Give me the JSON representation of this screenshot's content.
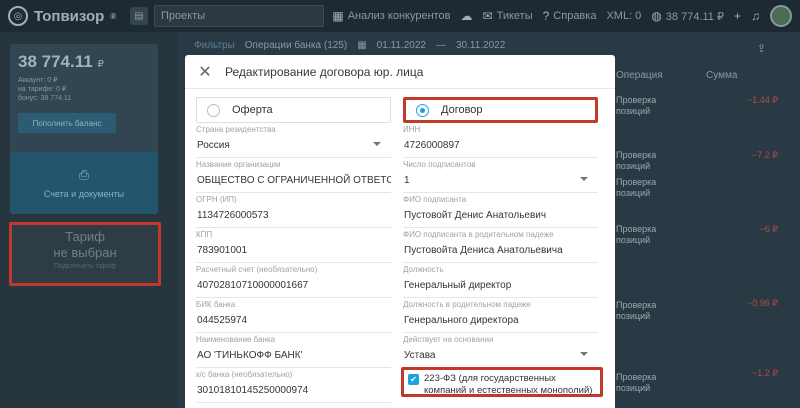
{
  "topbar": {
    "logo_text": "Топвизор",
    "logo_reg": "®",
    "projects_label": "Проекты",
    "competitors_label": "Анализ конкурентов",
    "tickets_label": "Тикеты",
    "help_label": "Справка",
    "xml_label": "XML: 0",
    "balance_label": "38 774.11 ₽",
    "plus_icon": "+"
  },
  "sidebar": {
    "balance_amount": "38 774.11",
    "balance_currency": "₽",
    "balance_line_1": "Аккаунт:   0 ₽",
    "balance_line_2": "на тарифе:   0 ₽",
    "balance_line_3": "бонус: 38 774.11",
    "topup_label": "Пополнить баланс",
    "docs_label": "Счета и документы",
    "tariff_title_1": "Тариф",
    "tariff_title_2": "не выбран",
    "tariff_sub": "Подключить тариф"
  },
  "content": {
    "filters_label": "Фильтры",
    "operations_label": "Операции банка",
    "operations_count": "(125)",
    "date_from": "01.11.2022",
    "date_to": "30.11.2022",
    "col_operation": "Операция",
    "col_sum": "Сумма",
    "rows": [
      {
        "op_1": "Проверка",
        "op_2": "позиций",
        "sum": "−1.44 ₽"
      },
      {
        "op_1": "Проверка",
        "op_2": "позиций",
        "sum": "−7.2 ₽"
      },
      {
        "op_1": "Проверка",
        "op_2": "позиций",
        "sum": ""
      },
      {
        "op_1": "Проверка",
        "op_2": "позиций",
        "sum": "−6 ₽"
      },
      {
        "op_1": "Проверка",
        "op_2": "позиций",
        "sum": ""
      },
      {
        "op_1": "Проверка",
        "op_2": "позиций",
        "sum": "−0.96 ₽"
      },
      {
        "op_1": "Проверка",
        "op_2": "позиций",
        "sum": "−1.2 ₽"
      }
    ]
  },
  "modal": {
    "title": "Редактирование договора юр. лица",
    "radio_offer": "Оферта",
    "radio_contract": "Договор",
    "left_fields": [
      {
        "label": "Страна резидентства",
        "value": "Россия",
        "select": true
      },
      {
        "label": "Название организации",
        "value": "ОБЩЕСТВО С ОГРАНИЧЕННОЙ ОТВЕТСТВЕННОСТЬЮ",
        "select": false
      },
      {
        "label": "ОГРН (ИП)",
        "value": "1134726000573",
        "select": false
      },
      {
        "label": "КПП",
        "value": "783901001",
        "select": false
      },
      {
        "label": "Расчетный счет (необязательно)",
        "value": "40702810710000001667",
        "select": false
      },
      {
        "label": "БИК банка",
        "value": "044525974",
        "select": false
      },
      {
        "label": "Наименование банка",
        "value": "АО 'ТИНЬКОФФ БАНК'",
        "select": false
      },
      {
        "label": "к/с банка (необязательно)",
        "value": "30101810145250000974",
        "select": false
      }
    ],
    "right_fields": [
      {
        "label": "ИНН",
        "value": "4726000897",
        "select": false
      },
      {
        "label": "Число подписантов",
        "value": "1",
        "select": true
      },
      {
        "label": "ФИО подписанта",
        "value": "Пустовойт Денис Анатольевич",
        "select": false
      },
      {
        "label": "ФИО подписанта в родительном падеже",
        "value": "Пустовойта Дениса Анатольевича",
        "select": false
      },
      {
        "label": "Должность",
        "value": "Генеральный директор",
        "select": false
      },
      {
        "label": "Должность в родительном падеже",
        "value": "Генерального директора",
        "select": false
      },
      {
        "label": "Действует на основании",
        "value": "Устава",
        "select": true
      }
    ],
    "checkbox_label": "223-ФЗ (для государственных компаний и естественных монополий)",
    "checkbox_checked": true
  },
  "colors": {
    "accent": "#1aa3e0",
    "highlight": "#c0392b",
    "negative": "#b24b42"
  }
}
